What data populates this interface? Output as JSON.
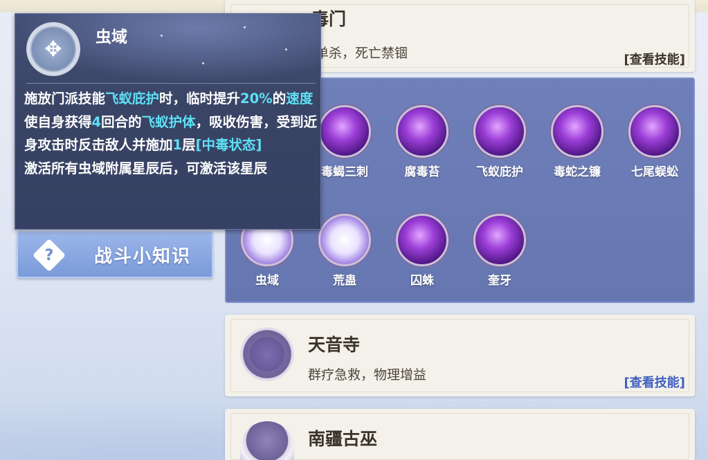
{
  "tooltip": {
    "title": "虫域",
    "icon": "wasp-icon",
    "p1": [
      {
        "t": "施放门派技能",
        "h": false
      },
      {
        "t": "飞蚁庇护",
        "h": true
      },
      {
        "t": "时，临时提升",
        "h": false
      },
      {
        "t": "20%",
        "h": true
      },
      {
        "t": "的",
        "h": false
      },
      {
        "t": "速度",
        "h": true
      },
      {
        "t": "使自身获得",
        "h": false
      },
      {
        "t": "4",
        "h": true
      },
      {
        "t": "回合的",
        "h": false
      },
      {
        "t": "飞蚁护体",
        "h": true
      },
      {
        "t": "，吸收伤害，受到近身攻击时反击敌人并施加",
        "h": false
      },
      {
        "t": "1",
        "h": true
      },
      {
        "t": "层",
        "h": false
      },
      {
        "t": "[中毒状态]",
        "h": true
      }
    ],
    "p2": "激活所有虫域附属星辰后，可激活该星辰"
  },
  "nav": {
    "battle_tips": "战斗小知识"
  },
  "top_card": {
    "name": "毒门",
    "desc": "理单杀，死亡禁锢",
    "view": "[查看技能]"
  },
  "skills": {
    "row1": [
      "毒蝎三刺",
      "腐毒苔",
      "飞蚁庇护",
      "毒蛇之镰",
      "七尾蜈蚣"
    ],
    "row2": [
      "虫域",
      "荒蛊",
      "囚蛛",
      "奎牙"
    ]
  },
  "card_tianyin": {
    "name": "天音寺",
    "desc": "群疗急救，物理增益",
    "view": "[查看技能]"
  },
  "card_nanjiang": {
    "name": "南疆古巫"
  },
  "colors": {
    "highlight": "#5ee0f5",
    "view_link": "#3e5fbf"
  }
}
